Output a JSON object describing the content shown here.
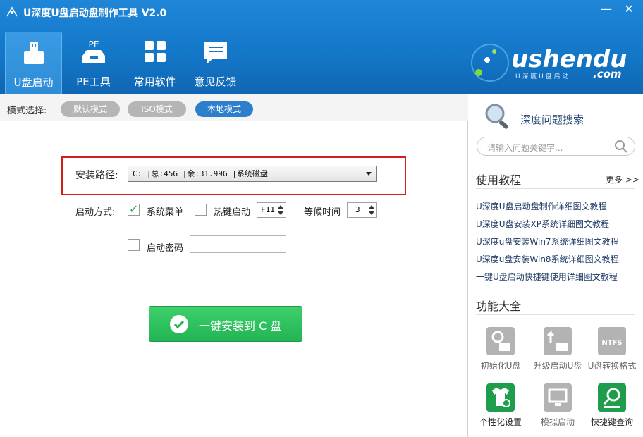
{
  "window": {
    "title": "U深度U盘启动盘制作工具 V2.0"
  },
  "nav": [
    {
      "label": "U盘启动",
      "active": true,
      "icon": "usb-drive-icon"
    },
    {
      "label": "PE工具",
      "active": false,
      "icon": "pe-tool-icon",
      "badge": "PE"
    },
    {
      "label": "常用软件",
      "active": false,
      "icon": "apps-grid-icon"
    },
    {
      "label": "意见反馈",
      "active": false,
      "icon": "feedback-icon"
    }
  ],
  "brand": {
    "text": "ushendu",
    "com": ".com",
    "tagline": "U 深 度 U 盘 启 动"
  },
  "mode_bar": {
    "label": "模式选择:",
    "modes": [
      {
        "label": "默认模式",
        "active": false
      },
      {
        "label": "ISO模式",
        "active": false
      },
      {
        "label": "本地模式",
        "active": true
      }
    ]
  },
  "install": {
    "path_label": "安装路径:",
    "path_value": "C: |总:45G |余:31.99G |系统磁盘",
    "boot_label": "启动方式:",
    "system_menu": {
      "label": "系统菜单",
      "checked": true
    },
    "hotkey": {
      "label": "热键启动",
      "checked": false,
      "value": "F11"
    },
    "wait": {
      "label": "等候时间",
      "value": "3"
    },
    "password": {
      "label": "启动密码",
      "checked": false,
      "value": ""
    },
    "button": "一键安装到 C 盘"
  },
  "side": {
    "search_title": "深度问题搜索",
    "search_placeholder": "请输入问题关键字...",
    "tutorials_title": "使用教程",
    "more": "更多 >>",
    "tutorials": [
      "U深度U盘启动盘制作详细图文教程",
      "U深度U盘安装XP系统详细图文教程",
      "U深度u盘安装Win7系统详细图文教程",
      "U深度u盘安装Win8系统详细图文教程",
      "一键U盘启动快捷键使用详细图文教程"
    ],
    "functions_title": "功能大全",
    "tools": [
      {
        "label": "初始化U盘",
        "icon": "init-usb-icon",
        "color": "#b3b3b3"
      },
      {
        "label": "升级启动U盘",
        "icon": "upgrade-usb-icon",
        "color": "#b3b3b3"
      },
      {
        "label": "U盘转换格式",
        "icon": "ntfs-convert-icon",
        "color": "#b3b3b3",
        "badge": "NTFS"
      },
      {
        "label": "个性化设置",
        "icon": "personalize-icon",
        "color": "#1e9e4c"
      },
      {
        "label": "模拟启动",
        "icon": "simulate-boot-icon",
        "color": "#b3b3b3"
      },
      {
        "label": "快捷键查询",
        "icon": "hotkey-query-icon",
        "color": "#1e9e4c"
      }
    ]
  },
  "colors": {
    "header": "#1478c9",
    "accent": "#2d7fcb",
    "install_button": "#2cc05c",
    "highlight_border": "#d21e1e"
  }
}
